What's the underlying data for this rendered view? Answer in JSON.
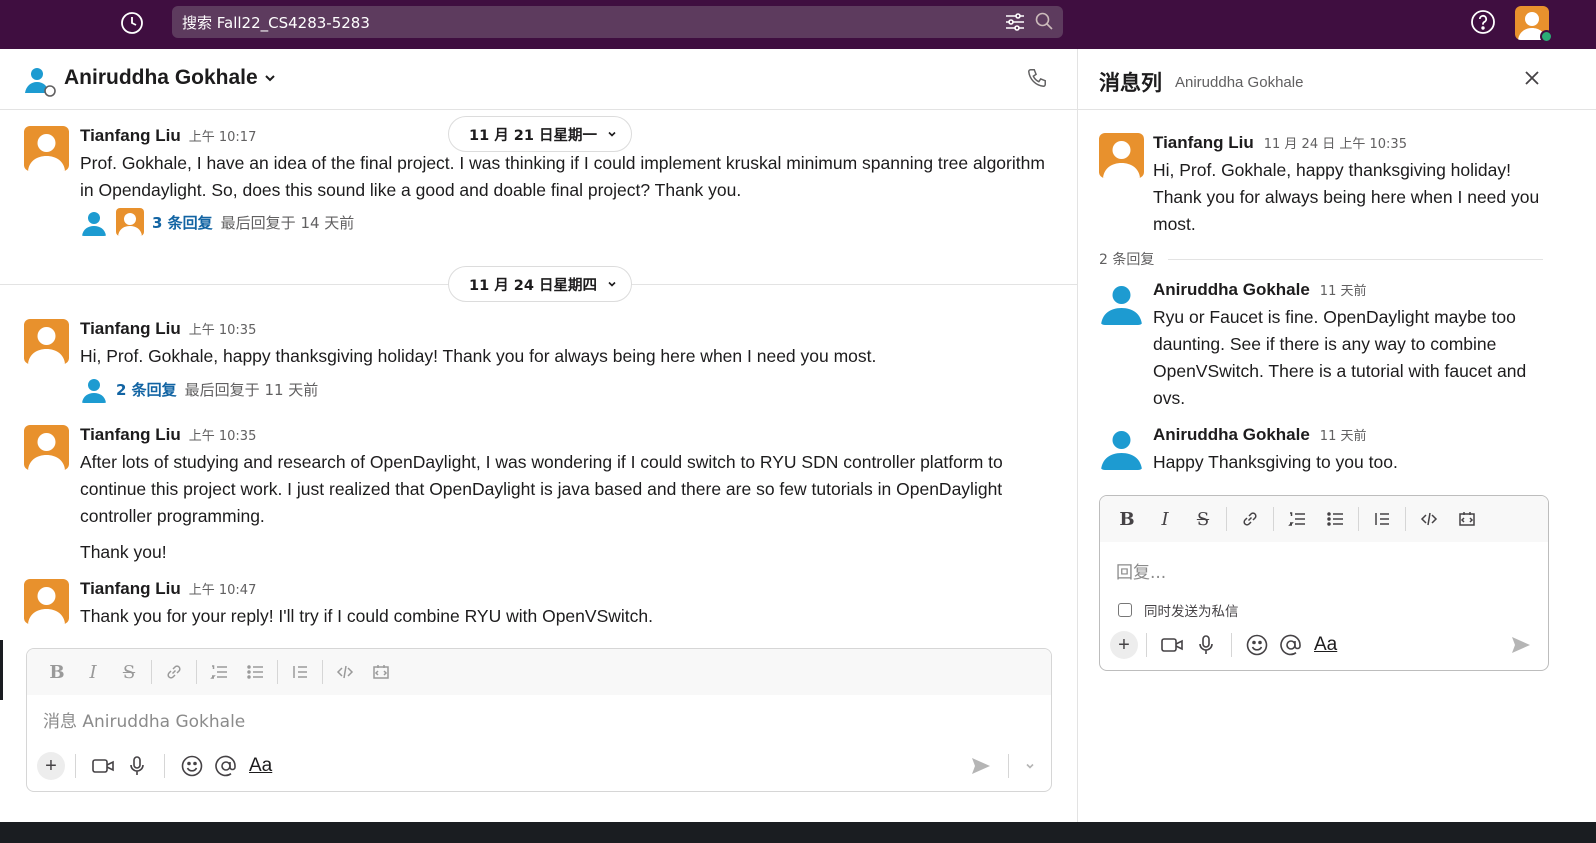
{
  "topbar": {
    "search_text": "搜索 Fall22_CS4283-5283",
    "icons": [
      "history-icon",
      "filter-icon",
      "search-icon",
      "help-icon",
      "user-avatar",
      "presence-dot"
    ]
  },
  "channel": {
    "title": "Aniruddha Gokhale"
  },
  "date_dividers": [
    "11 月 21 日星期一",
    "11 月 24 日星期四"
  ],
  "messages": [
    {
      "author": "Tianfang Liu",
      "time": "上午 10:17",
      "text": "Prof. Gokhale, I have an idea of the final project. I was thinking if I could implement kruskal minimum spanning tree algorithm in Opendaylight. So, does this sound like a good and doable final project? Thank you.",
      "replies": "3 条回复",
      "last_reply": "最后回复于 14 天前"
    },
    {
      "author": "Tianfang Liu",
      "time": "上午 10:35",
      "text": "Hi, Prof. Gokhale, happy thanksgiving holiday! Thank you for always being here when I need you most.",
      "replies": "2 条回复",
      "last_reply": "最后回复于 11 天前"
    },
    {
      "author": "Tianfang Liu",
      "time": "上午 10:35",
      "text": "After lots of studying and research of OpenDaylight, I was wondering if I could switch to RYU SDN controller platform to continue this project work. I just realized that OpenDaylight is java based and there are so few tutorials in OpenDaylight controller programming.",
      "text2": "Thank you!"
    },
    {
      "author": "Tianfang Liu",
      "time": "上午 10:47",
      "text": "Thank you for your reply! I'll try if I could combine RYU with OpenVSwitch."
    }
  ],
  "composer": {
    "placeholder": "消息 Aniruddha Gokhale",
    "format_icons": [
      "B",
      "I",
      "S"
    ],
    "aa_label": "Aa"
  },
  "thread": {
    "title": "消息列",
    "subtitle": "Aniruddha Gokhale",
    "parent": {
      "author": "Tianfang Liu",
      "time": "11 月 24 日 上午 10:35",
      "text": "Hi, Prof. Gokhale, happy thanksgiving holiday! Thank you for always being here when I need you most."
    },
    "reply_count": "2 条回复",
    "replies": [
      {
        "author": "Aniruddha Gokhale",
        "time": "11 天前",
        "text": "Ryu or Faucet is fine. OpenDaylight maybe too daunting. See if there is any way to combine OpenVSwitch. There is a tutorial with faucet and ovs."
      },
      {
        "author": "Aniruddha Gokhale",
        "time": "11 天前",
        "text": "Happy Thanksgiving to you too."
      }
    ],
    "composer_placeholder": "回复...",
    "also_send_label": "同时发送为私信",
    "aa_label": "Aa"
  },
  "colors": {
    "topbar": "#3f0e40",
    "search": "#5d3b5e",
    "link": "#1264a3",
    "avatar_orange": "#e8912d",
    "avatar_blue": "#1d9bd1",
    "presence": "#2bac76"
  }
}
